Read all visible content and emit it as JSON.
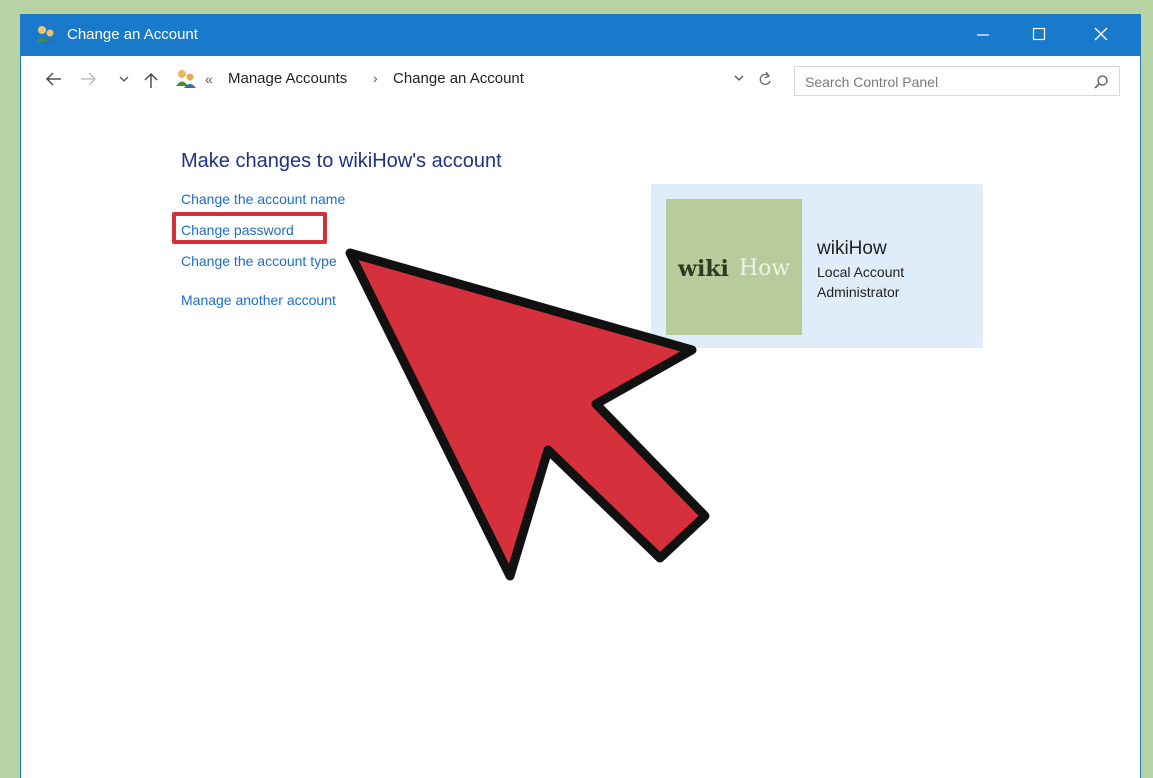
{
  "window": {
    "title": "Change an Account",
    "title_icon": "user-accounts-icon"
  },
  "navbar": {
    "back_icon": "back-arrow-icon",
    "forward_icon": "forward-arrow-icon",
    "recent_icon": "chevron-down-icon",
    "up_icon": "up-arrow-icon",
    "address": {
      "icon": "user-accounts-icon",
      "overflow": "«",
      "crumbs": [
        "Manage Accounts",
        "Change an Account"
      ],
      "separator": "›"
    },
    "search": {
      "placeholder": "Search Control Panel",
      "value": ""
    }
  },
  "main": {
    "heading": "Make changes to wikiHow's account",
    "links": [
      "Change the account name",
      "Change password",
      "Change the account type",
      "Manage another account"
    ]
  },
  "account": {
    "avatar_text_1": "wiki",
    "avatar_text_2": "How",
    "name": "wikiHow",
    "type": "Local Account",
    "role": "Administrator"
  },
  "colors": {
    "titlebar": "#1979ca",
    "heading": "#1e3287",
    "link": "#1e6ccf",
    "highlight": "#d4303c",
    "pointer": "#d7303d",
    "card": "#deedf9",
    "avatar": "#b7cc9a",
    "background": "#b8d3a3"
  },
  "overlay": {
    "pointer_icon": "red-cursor-arrow-icon"
  }
}
